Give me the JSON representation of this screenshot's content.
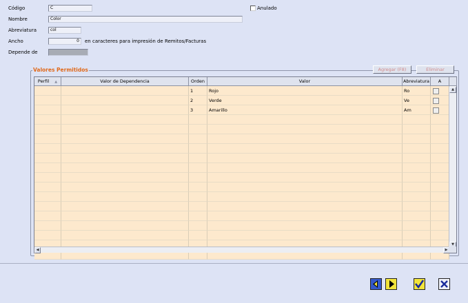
{
  "form": {
    "codigo": {
      "label": "Código",
      "value": "C"
    },
    "nombre": {
      "label": "Nombre",
      "value": "Color"
    },
    "abreviatura": {
      "label": "Abreviatura",
      "value": "col"
    },
    "ancho": {
      "label": "Ancho",
      "value": "0",
      "hint": "en caracteres para impresión de Remitos/Facturas"
    },
    "depende": {
      "label": "Depende de",
      "value": ""
    },
    "anulado": {
      "label": "Anulado",
      "checked": false
    }
  },
  "group": {
    "title": "Valores Permitidos",
    "add_label": "Agregar (F8)",
    "delete_label": "Eliminar"
  },
  "grid": {
    "columns": [
      "Perfil",
      "Valor de Dependencia",
      "Orden",
      "Valor",
      "Abreviatura",
      "A"
    ],
    "sort_indicator": "▲",
    "rows": [
      {
        "perfil": "",
        "dependencia": "",
        "orden": "1",
        "valor": "Rojo",
        "abreviatura": "Ro",
        "a": false
      },
      {
        "perfil": "",
        "dependencia": "",
        "orden": "2",
        "valor": "Verde",
        "abreviatura": "Ve",
        "a": false
      },
      {
        "perfil": "",
        "dependencia": "",
        "orden": "3",
        "valor": "Amarillo",
        "abreviatura": "Am",
        "a": false
      }
    ],
    "empty_rows": 15
  },
  "footer": {
    "icons": [
      "nav-prev-icon",
      "nav-next-icon",
      "confirm-check-icon",
      "cancel-x-icon"
    ]
  },
  "colors": {
    "background": "#dde3f5",
    "group_title": "#e06a1c",
    "row_fill": "#fde9cd",
    "disabled_button_text": "#d08a8a"
  }
}
